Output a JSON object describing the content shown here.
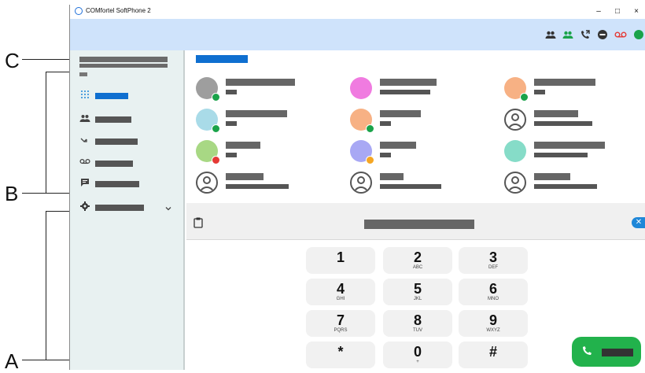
{
  "callouts": {
    "a": "A",
    "b": "B",
    "c": "C"
  },
  "window": {
    "title": "COMfortel SoftPhone 2",
    "controls": {
      "minimize": "–",
      "maximize": "□",
      "close": "×"
    }
  },
  "toolbar": {
    "icons": [
      "contacts-icon",
      "online-contacts-icon",
      "call-forward-icon",
      "dnd-icon",
      "voicemail-icon",
      "status-dot-icon"
    ]
  },
  "sidebar": {
    "items": [
      {
        "icon": "dialpad-icon",
        "active": true
      },
      {
        "icon": "contacts-icon"
      },
      {
        "icon": "calls-icon"
      },
      {
        "icon": "voicemail-icon"
      },
      {
        "icon": "chat-icon"
      },
      {
        "icon": "settings-icon"
      }
    ]
  },
  "contacts": [
    {
      "avatar": "#9e9e9e",
      "presence": "#1aa34a"
    },
    {
      "avatar": "#f07be0",
      "presence": ""
    },
    {
      "avatar": "#f7b184",
      "presence": "#1aa34a"
    },
    {
      "avatar": "#a9dbe8",
      "presence": "#1aa34a"
    },
    {
      "avatar": "#f7b184",
      "presence": "#1aa34a"
    },
    {
      "avatar": "generic",
      "presence": ""
    },
    {
      "avatar": "#a8d884",
      "presence": "#e53935"
    },
    {
      "avatar": "#a8a8f4",
      "presence": "#f5a623"
    },
    {
      "avatar": "#86dcc8",
      "presence": ""
    },
    {
      "avatar": "generic",
      "presence": ""
    },
    {
      "avatar": "generic",
      "presence": ""
    },
    {
      "avatar": "generic",
      "presence": ""
    }
  ],
  "dialpad": {
    "keys": [
      {
        "digit": "1",
        "letters": ""
      },
      {
        "digit": "2",
        "letters": "ABC"
      },
      {
        "digit": "3",
        "letters": "DEF"
      },
      {
        "digit": "4",
        "letters": "GHI"
      },
      {
        "digit": "5",
        "letters": "JKL"
      },
      {
        "digit": "6",
        "letters": "MNO"
      },
      {
        "digit": "7",
        "letters": "PQRS"
      },
      {
        "digit": "8",
        "letters": "TUV"
      },
      {
        "digit": "9",
        "letters": "WXYZ"
      },
      {
        "digit": "*",
        "letters": ""
      },
      {
        "digit": "0",
        "letters": "+"
      },
      {
        "digit": "#",
        "letters": ""
      }
    ],
    "backspace_glyph": "✕",
    "call_glyph": "✆"
  },
  "colors": {
    "accent": "#0f6fd0",
    "toolbar_bg": "#cfe3fb",
    "sidebar_bg": "#e8f1f1",
    "call_green": "#22b24c",
    "voicemail_red": "#e53935"
  }
}
